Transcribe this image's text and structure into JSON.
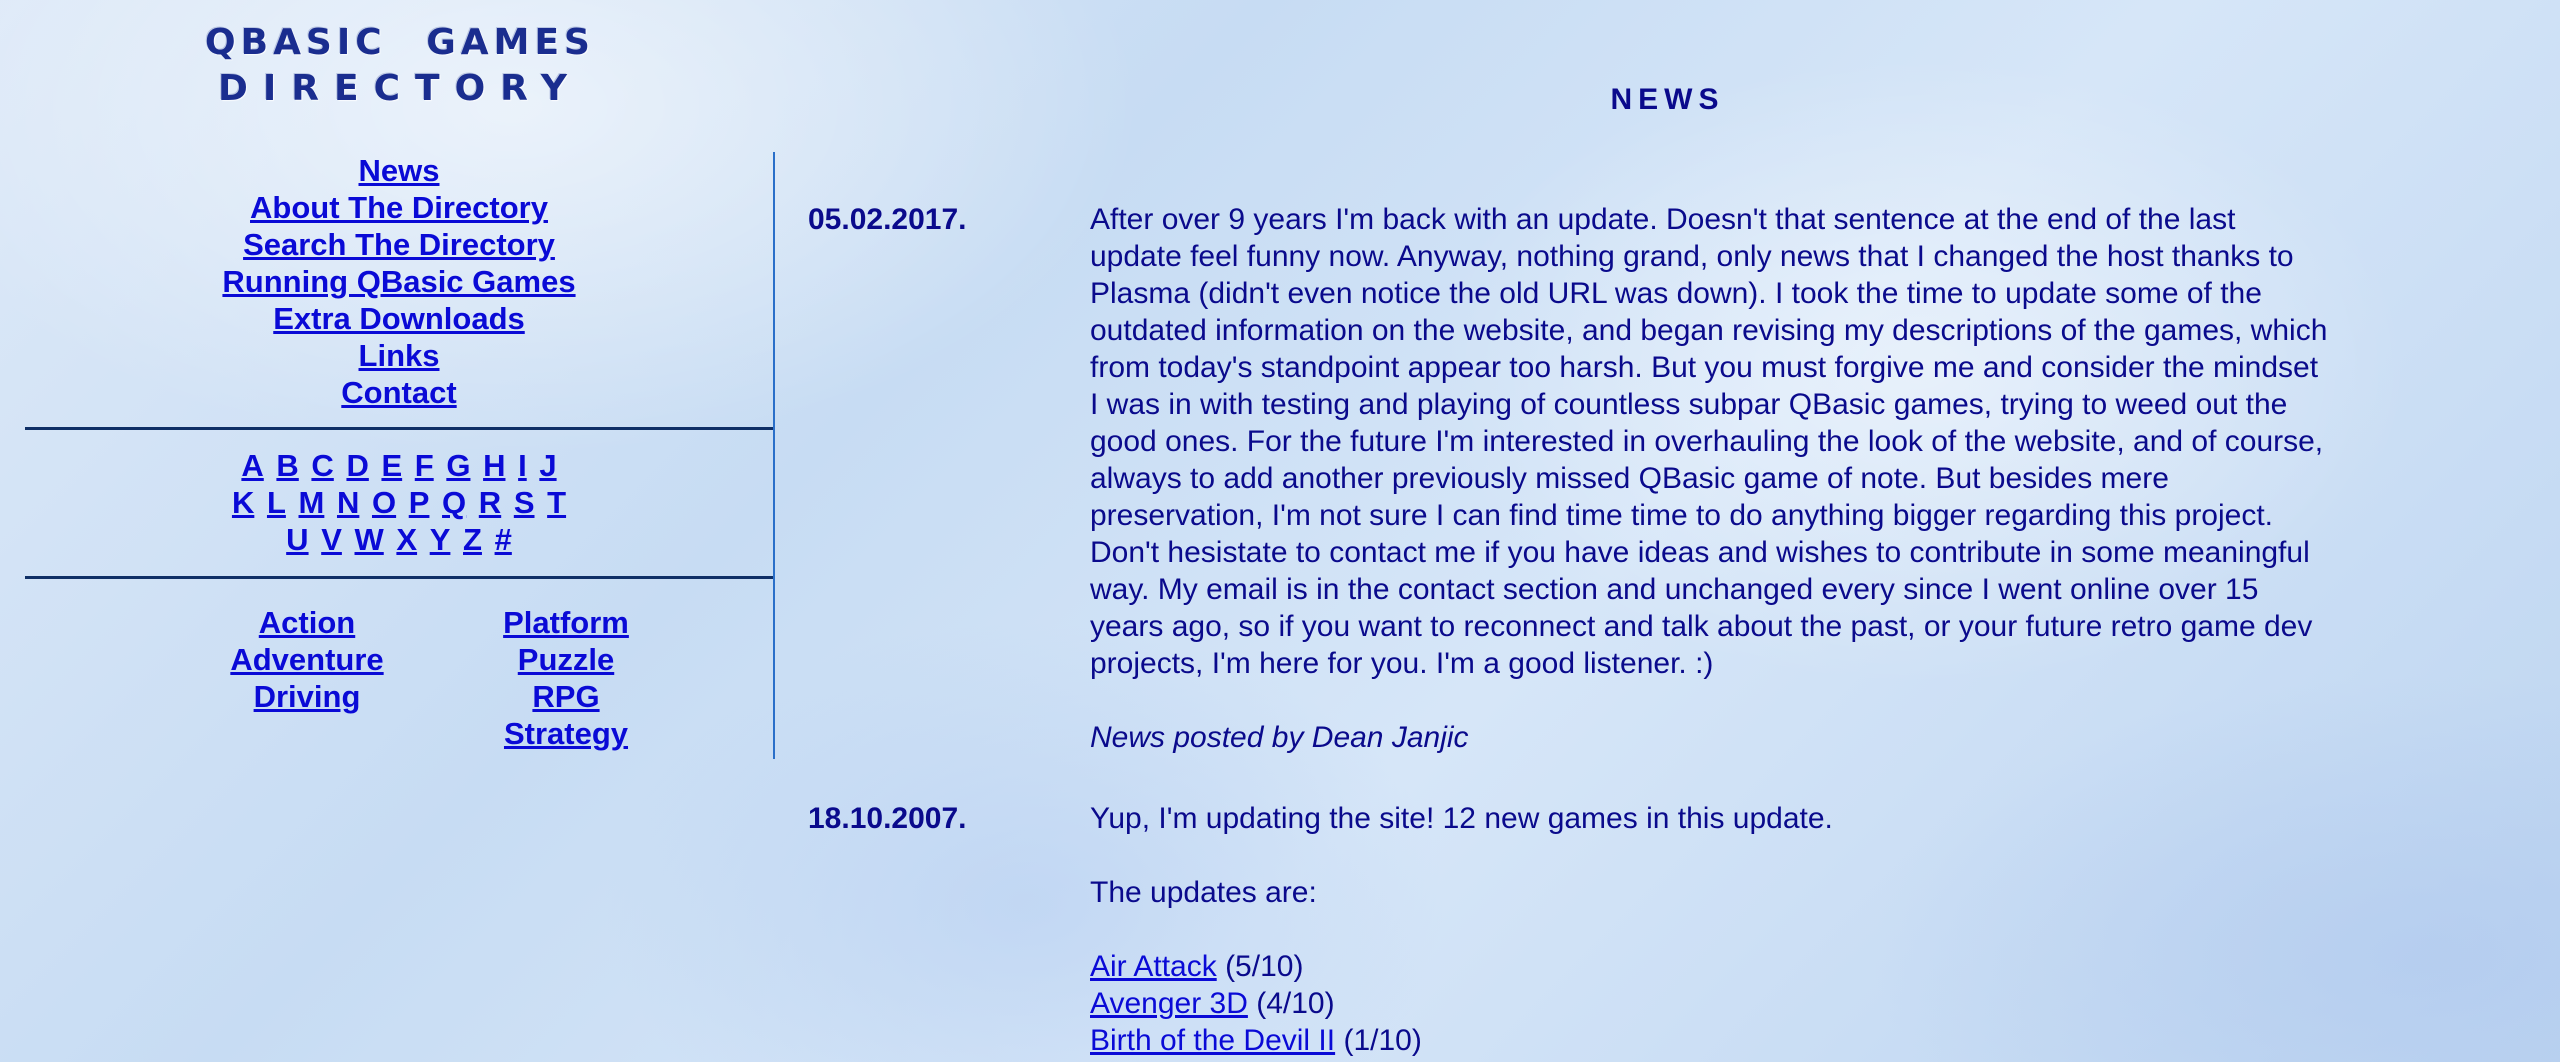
{
  "site": {
    "logo_line1": "QBASIC GAMES",
    "logo_line2": "DIRECTORY"
  },
  "nav": {
    "items": [
      {
        "label": "News"
      },
      {
        "label": "About The Directory"
      },
      {
        "label": "Search The Directory"
      },
      {
        "label": "Running QBasic Games"
      },
      {
        "label": "Extra Downloads"
      },
      {
        "label": "Links"
      },
      {
        "label": "Contact"
      }
    ]
  },
  "letters": {
    "row1": [
      "A",
      "B",
      "C",
      "D",
      "E",
      "F",
      "G",
      "H",
      "I",
      "J"
    ],
    "row2": [
      "K",
      "L",
      "M",
      "N",
      "O",
      "P",
      "Q",
      "R",
      "S",
      "T"
    ],
    "row3": [
      "U",
      "V",
      "W",
      "X",
      "Y",
      "Z",
      "#"
    ]
  },
  "genres": {
    "col1": [
      "Action",
      "Adventure",
      "Driving"
    ],
    "col2": [
      "Platform",
      "Puzzle",
      "RPG",
      "Strategy"
    ]
  },
  "news": {
    "title": "NEWS",
    "entries": [
      {
        "date": "05.02.2017.",
        "text": "After over 9 years I'm back with an update. Doesn't that sentence at the end of the last update feel funny now. Anyway, nothing grand, only news that I changed the host thanks to Plasma (didn't even notice the old URL was down). I took the time to update some of the outdated information on the website, and began revising my descriptions of the games, which from today's standpoint appear too harsh. But you must forgive me and consider the mindset I was in with testing and playing of countless subpar QBasic games, trying to weed out the good ones. For the future I'm interested in overhauling the look of the website, and of course, always to add another previously missed QBasic game of note. But besides mere preservation, I'm not sure I can find time time to do anything bigger regarding this project. Don't hesistate to contact me if you have ideas and wishes to contribute in some meaningful way. My email is in the contact section and unchanged every since I went online over 15 years ago, so if you want to reconnect and talk about the past, or your future retro game dev projects, I'm here for you. I'm a good listener. :)",
        "signature": "News posted by Dean Janjic"
      },
      {
        "date": "18.10.2007.",
        "text": "Yup, I'm updating the site! 12 new games in this update.",
        "updates_label": "The updates are:",
        "updates": [
          {
            "name": "Air Attack",
            "rating": "(5/10)"
          },
          {
            "name": "Avenger 3D",
            "rating": "(4/10)"
          },
          {
            "name": "Birth of the Devil II",
            "rating": "(1/10)"
          }
        ]
      }
    ]
  }
}
